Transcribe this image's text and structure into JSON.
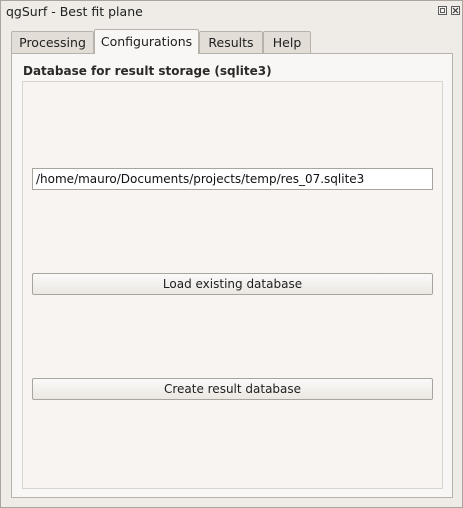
{
  "window": {
    "title": "qgSurf - Best fit plane",
    "float_icon": "float-window-icon",
    "close_icon": "close-icon"
  },
  "tabs": [
    {
      "label": "Processing",
      "active": false
    },
    {
      "label": "Configurations",
      "active": true
    },
    {
      "label": "Results",
      "active": false
    },
    {
      "label": "Help",
      "active": false
    }
  ],
  "configurations": {
    "group_title": "Database for result storage (sqlite3)",
    "db_path": "/home/mauro/Documents/projects/temp/res_07.sqlite3",
    "load_button": "Load existing database",
    "create_button": "Create result database"
  }
}
